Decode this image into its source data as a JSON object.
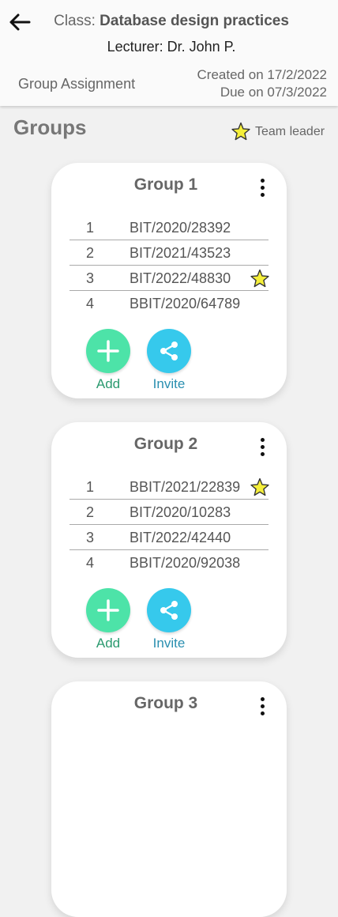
{
  "header": {
    "class_prefix": "Class: ",
    "class_name": "Database design practices",
    "lecturer": "Lecturer: Dr. John P.",
    "assignment_type": "Group Assignment",
    "created": "Created on 17/2/2022",
    "due": "Due on 07/3/2022"
  },
  "section_title": "Groups",
  "legend_label": "Team leader",
  "star_color": "#f5ef3a",
  "actions": {
    "add_label": "Add",
    "invite_label": "Invite"
  },
  "groups": [
    {
      "title": "Group 1",
      "members": [
        {
          "num": "1",
          "id": "BIT/2020/28392",
          "leader": false
        },
        {
          "num": "2",
          "id": "BIT/2021/43523",
          "leader": false
        },
        {
          "num": "3",
          "id": "BIT/2022/48830",
          "leader": true
        },
        {
          "num": "4",
          "id": "BBIT/2020/64789",
          "leader": false
        }
      ]
    },
    {
      "title": "Group 2",
      "members": [
        {
          "num": "1",
          "id": "BBIT/2021/22839",
          "leader": true
        },
        {
          "num": "2",
          "id": "BIT/2020/10283",
          "leader": false
        },
        {
          "num": "3",
          "id": "BIT/2022/42440",
          "leader": false
        },
        {
          "num": "4",
          "id": "BBIT/2020/92038",
          "leader": false
        }
      ]
    },
    {
      "title": "Group 3",
      "members": []
    }
  ]
}
